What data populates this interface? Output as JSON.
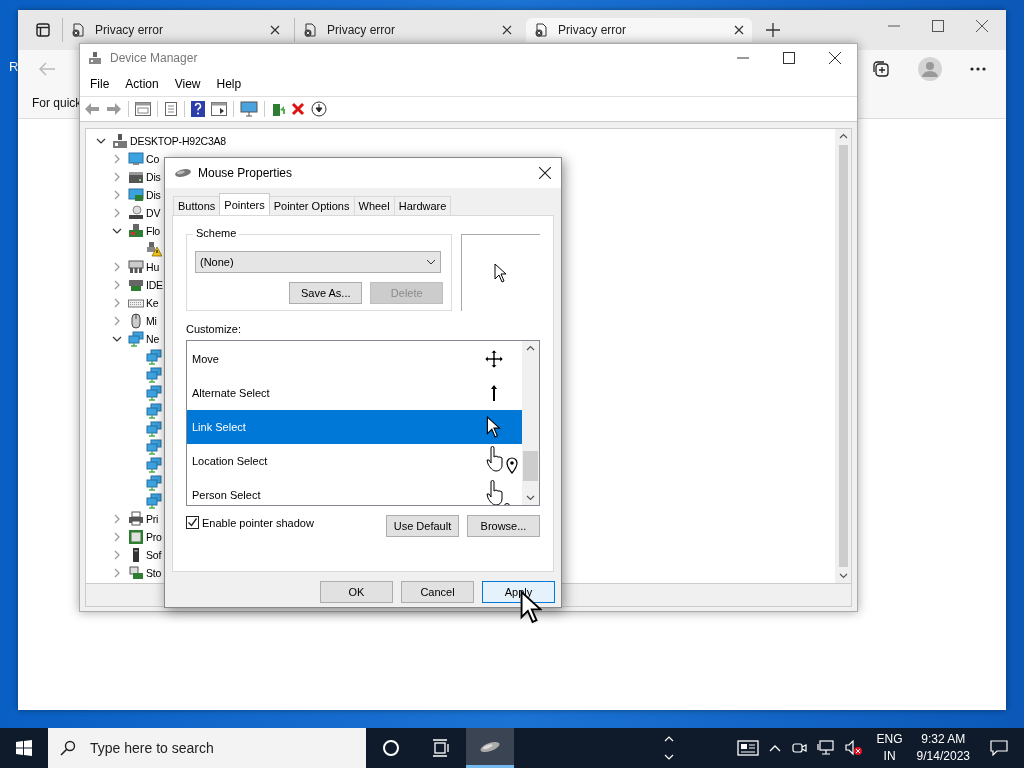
{
  "desktop": {
    "icon_labels": [
      "R"
    ]
  },
  "browser": {
    "tabs": [
      {
        "title": "Privacy error",
        "selected": false
      },
      {
        "title": "Privacy error",
        "selected": false
      },
      {
        "title": "Privacy error",
        "selected": true
      }
    ],
    "favorites_bar": {
      "text": "For quick"
    }
  },
  "device_manager": {
    "title": "Device Manager",
    "menu": [
      "File",
      "Action",
      "View",
      "Help"
    ],
    "tree": {
      "label": "DESKTOP-H92C3A8",
      "expanded": true,
      "children": [
        {
          "label": "Co",
          "kind": "monitor",
          "expanded": false
        },
        {
          "label": "Dis",
          "kind": "disk",
          "expanded": false
        },
        {
          "label": "Dis",
          "kind": "display",
          "expanded": false
        },
        {
          "label": "DV",
          "kind": "dvd",
          "expanded": false
        },
        {
          "label": "Flo",
          "kind": "floppy",
          "expanded": true,
          "children": [
            {
              "kind": "warning"
            }
          ]
        },
        {
          "label": "Hu",
          "kind": "hid",
          "expanded": false
        },
        {
          "label": "IDE",
          "kind": "ide",
          "expanded": false
        },
        {
          "label": "Ke",
          "kind": "keyboard",
          "expanded": false
        },
        {
          "label": "Mi",
          "kind": "mouse",
          "expanded": false
        },
        {
          "label": "Ne",
          "kind": "network",
          "expanded": true,
          "children": [
            {
              "kind": "network"
            },
            {
              "kind": "network"
            },
            {
              "kind": "network"
            },
            {
              "kind": "network"
            },
            {
              "kind": "network"
            },
            {
              "kind": "network"
            },
            {
              "kind": "network"
            },
            {
              "kind": "network"
            },
            {
              "kind": "network"
            }
          ]
        },
        {
          "label": "Pri",
          "kind": "printer",
          "expanded": false
        },
        {
          "label": "Pro",
          "kind": "processor",
          "expanded": false
        },
        {
          "label": "Sof",
          "kind": "software",
          "expanded": false
        },
        {
          "label": "Sto",
          "kind": "storage",
          "expanded": false
        }
      ]
    }
  },
  "mouse_properties": {
    "title": "Mouse Properties",
    "tabs": [
      {
        "label": "Buttons",
        "selected": false
      },
      {
        "label": "Pointers",
        "selected": true
      },
      {
        "label": "Pointer Options",
        "selected": false
      },
      {
        "label": "Wheel",
        "selected": false
      },
      {
        "label": "Hardware",
        "selected": false
      }
    ],
    "scheme": {
      "label": "Scheme",
      "value": "(None)",
      "buttons": [
        {
          "label": "Save As...",
          "disabled": false
        },
        {
          "label": "Delete",
          "disabled": true
        }
      ]
    },
    "customize": {
      "label": "Customize:",
      "items": [
        {
          "name": "Move",
          "kind": "move",
          "selected": false
        },
        {
          "name": "Alternate Select",
          "kind": "up-arrow",
          "selected": false
        },
        {
          "name": "Link Select",
          "kind": "arrow",
          "selected": true
        },
        {
          "name": "Location Select",
          "kind": "hand-pin",
          "selected": false
        },
        {
          "name": "Person Select",
          "kind": "hand-person",
          "selected": false
        }
      ]
    },
    "pointer_shadow": {
      "label": "Enable pointer shadow",
      "checked": true
    },
    "list_buttons": [
      "Use Default",
      "Browse..."
    ],
    "buttons": [
      {
        "label": "OK",
        "focused": false
      },
      {
        "label": "Cancel",
        "focused": false
      },
      {
        "label": "Apply",
        "focused": true
      }
    ]
  },
  "taskbar": {
    "search_placeholder": "Type here to search",
    "language": [
      "ENG",
      "IN"
    ],
    "time": "9:32 AM",
    "date": "9/14/2023"
  }
}
